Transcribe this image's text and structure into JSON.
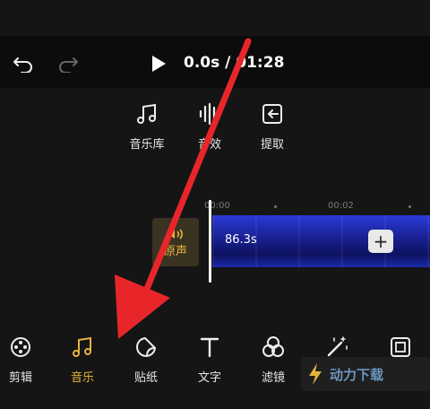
{
  "header": {
    "time_display": "0.0s / 01:28"
  },
  "sub_toolbar": {
    "items": [
      {
        "label": "音乐库"
      },
      {
        "label": "音效"
      },
      {
        "label": "提取"
      }
    ]
  },
  "timeline": {
    "ruler_labels": [
      "00:00",
      "00:02"
    ],
    "audio_track_label": "原声",
    "clip_duration": "86.3s",
    "add_button": "+"
  },
  "bottom_toolbar": {
    "items": [
      {
        "label": "剪辑"
      },
      {
        "label": "音乐"
      },
      {
        "label": "贴纸"
      },
      {
        "label": "文字"
      },
      {
        "label": "滤镜"
      },
      {
        "label": "特效"
      },
      {
        "label": "比例"
      }
    ],
    "active_color": "#e5b43c"
  },
  "annotation": {
    "arrow_color": "#e8262a"
  },
  "watermark": {
    "text": "动力下载"
  }
}
